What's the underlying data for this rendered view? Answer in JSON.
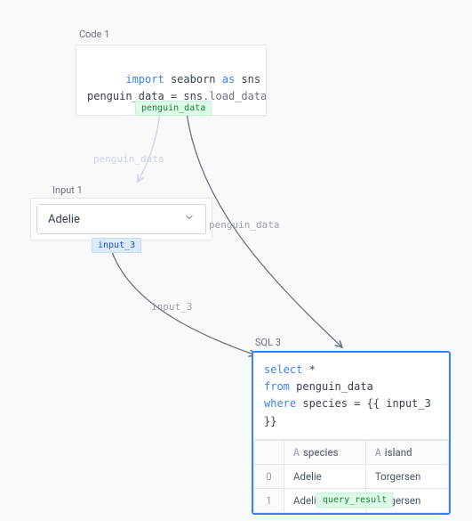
{
  "code_node": {
    "label": "Code 1",
    "line1_kw": "import",
    "line1_mod": "seaborn",
    "line1_as": "as",
    "line1_alias": "sns",
    "line2_var": "penguin_data",
    "line2_eq": " = ",
    "line2_obj": "sns",
    "line2_call": ".load_dataset(",
    "output_tag": "penguin_data"
  },
  "input_node": {
    "label": "Input 1",
    "value": "Adelie",
    "output_tag": "input_3"
  },
  "edges": {
    "penguin_data_faded": "penguin_data",
    "penguin_data": "penguin_data",
    "input_3": "input_3"
  },
  "sql_node": {
    "label": "SQL 3",
    "line1_kw": "select",
    "line1_rest": " *",
    "line2_kw": "from",
    "line2_rest": " penguin_data",
    "line3_kw": "where",
    "line3_rest": " species = {{ input_3 }}",
    "columns": {
      "c1": "species",
      "c2": "island"
    },
    "type_glyph": "A",
    "rows": {
      "r0": {
        "idx": "0",
        "species": "Adelie",
        "island": "Torgersen"
      },
      "r1": {
        "idx": "1",
        "species": "Adelie",
        "island": "Torgersen"
      }
    },
    "output_tag": "query_result"
  }
}
